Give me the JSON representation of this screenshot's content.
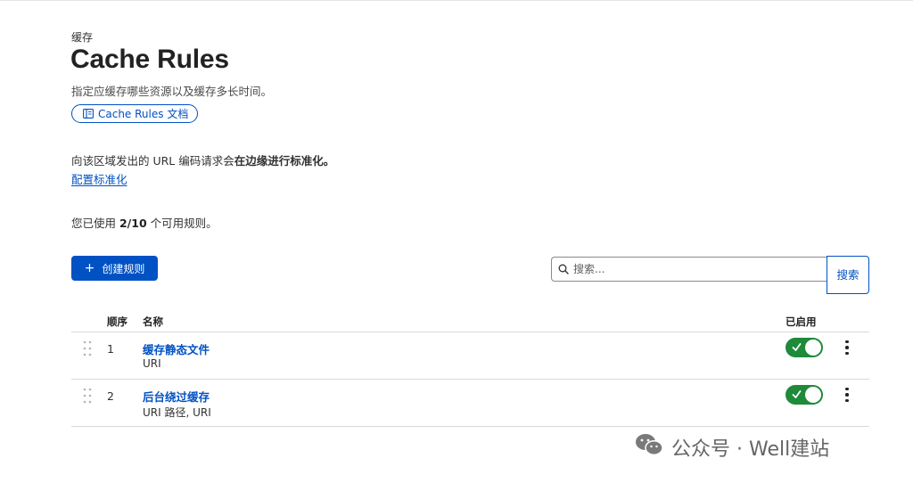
{
  "header": {
    "breadcrumb": "缓存",
    "title": "Cache Rules",
    "subtitle": "指定应缓存哪些资源以及缓存多长时间。",
    "docs_link": "Cache Rules 文档"
  },
  "normalization": {
    "text_prefix": "向该区域发出的 URL 编码请求会",
    "text_bold": "在边缘进行标准化。",
    "link": "配置标准化"
  },
  "usage": {
    "prefix": "您已使用 ",
    "count": "2/10",
    "suffix": " 个可用规则。"
  },
  "toolbar": {
    "create_label": "创建规则",
    "search_placeholder": "搜索...",
    "search_button": "搜索"
  },
  "table": {
    "columns": {
      "order": "顺序",
      "name": "名称",
      "enabled": "已启用"
    },
    "rows": [
      {
        "order": "1",
        "name": "缓存静态文件",
        "desc": "URI",
        "enabled": true
      },
      {
        "order": "2",
        "name": "后台绕过缓存",
        "desc": "URI 路径, URI",
        "enabled": true
      }
    ]
  },
  "watermark": {
    "text": "公众号 · Well建站"
  },
  "colors": {
    "accent": "#0051c3",
    "toggle_on": "#1e8a3a"
  }
}
